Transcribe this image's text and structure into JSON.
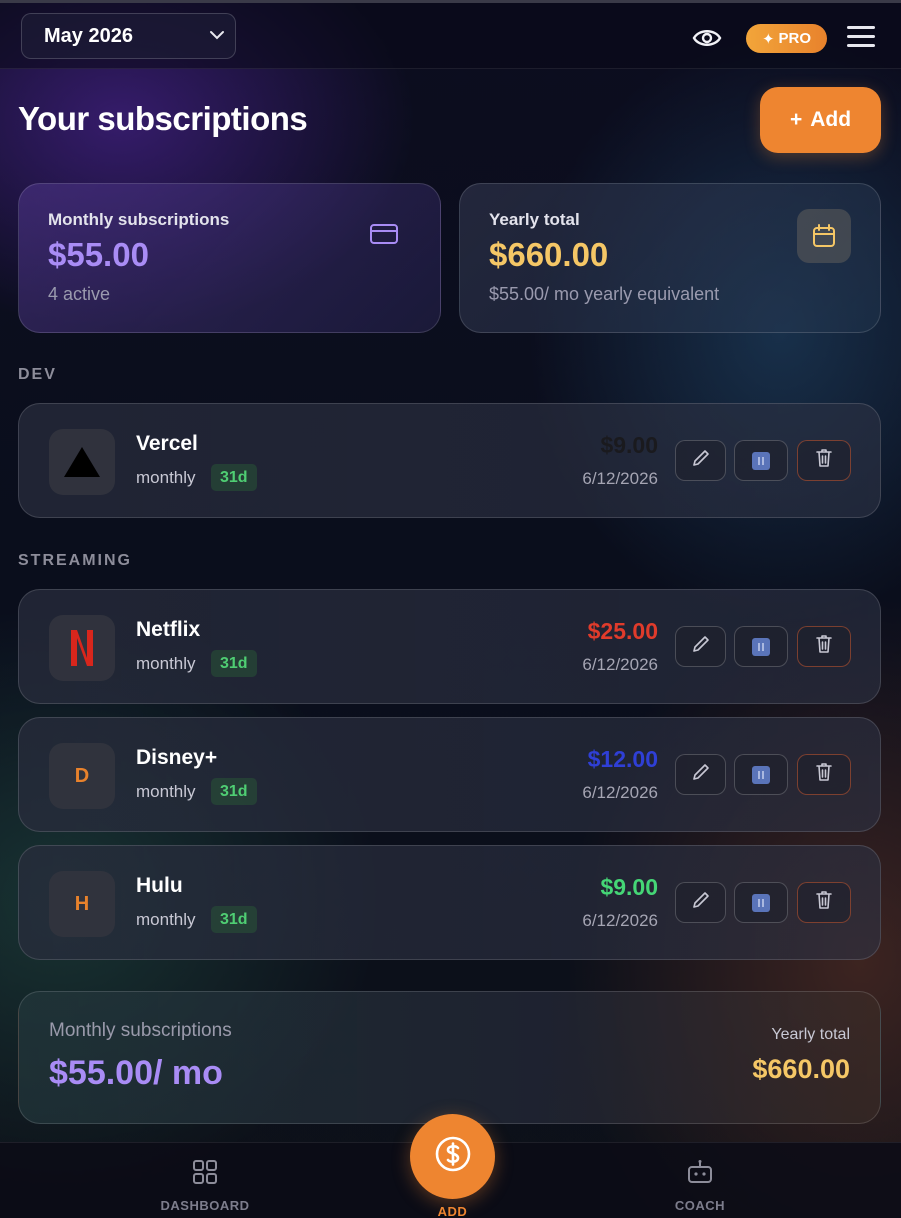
{
  "header": {
    "month": "May 2026",
    "pro_label": "PRO"
  },
  "page": {
    "title": "Your subscriptions",
    "add_label": "Add"
  },
  "stats": {
    "monthly": {
      "label": "Monthly subscriptions",
      "value": "$55.00",
      "sub": "4 active"
    },
    "yearly": {
      "label": "Yearly total",
      "value": "$660.00",
      "sub": "$55.00/ mo yearly equivalent"
    }
  },
  "sections": {
    "dev": {
      "label": "DEV",
      "items": [
        {
          "name": "Vercel",
          "cycle": "monthly",
          "days": "31d",
          "price": "$9.00",
          "price_color": "#1a1a1e",
          "date": "6/12/2026",
          "logo": "vercel-logo"
        }
      ]
    },
    "streaming": {
      "label": "STREAMING",
      "items": [
        {
          "name": "Netflix",
          "cycle": "monthly",
          "days": "31d",
          "price": "$25.00",
          "price_color": "#e03b2b",
          "date": "6/12/2026",
          "logo": "netflix-logo"
        },
        {
          "name": "Disney+",
          "cycle": "monthly",
          "days": "31d",
          "price": "$12.00",
          "price_color": "#2f3fd6",
          "date": "6/12/2026",
          "logo_letter": "D"
        },
        {
          "name": "Hulu",
          "cycle": "monthly",
          "days": "31d",
          "price": "$9.00",
          "price_color": "#45d676",
          "date": "6/12/2026",
          "logo_letter": "H"
        }
      ]
    }
  },
  "summary": {
    "label": "Monthly subscriptions",
    "value": "$55.00/ mo",
    "yearly_label": "Yearly total",
    "yearly_value": "$660.00"
  },
  "nav": {
    "dashboard": "DASHBOARD",
    "add": "ADD",
    "coach": "COACH"
  },
  "colors": {
    "accent": "#ee8530",
    "monthly": "#a98cf5",
    "yearly": "#f5c766",
    "days_badge": "#4fce73"
  }
}
